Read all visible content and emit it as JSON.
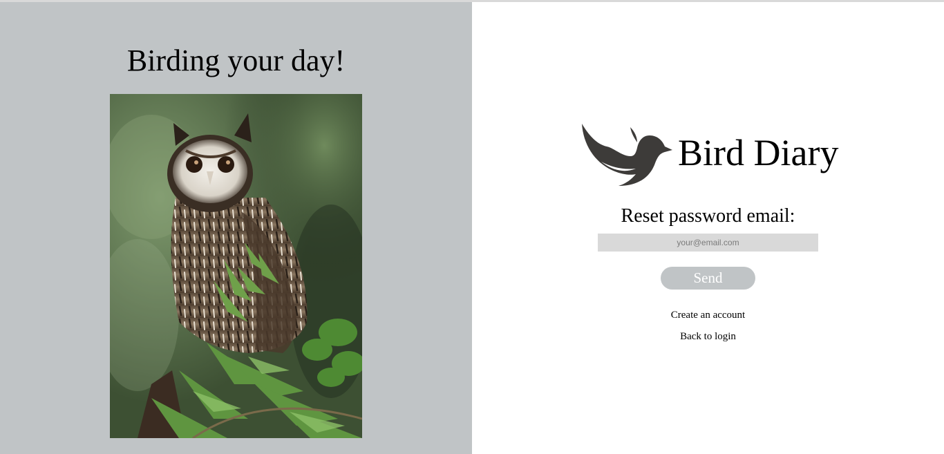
{
  "left_panel": {
    "tagline": "Birding your day!",
    "photo_alt": "owl-photo"
  },
  "brand": {
    "name": "Bird Diary",
    "logo_icon": "bird-icon",
    "logo_color": "#3d3b39"
  },
  "reset_form": {
    "label": "Reset password email:",
    "email_placeholder": "your@email.com",
    "email_value": "",
    "send_label": "Send"
  },
  "links": {
    "create_account": "Create an account",
    "back_to_login": "Back to login"
  },
  "colors": {
    "panel_gray": "#c0c4c6",
    "input_gray": "#d9d9d9",
    "button_text": "#ffffff"
  }
}
